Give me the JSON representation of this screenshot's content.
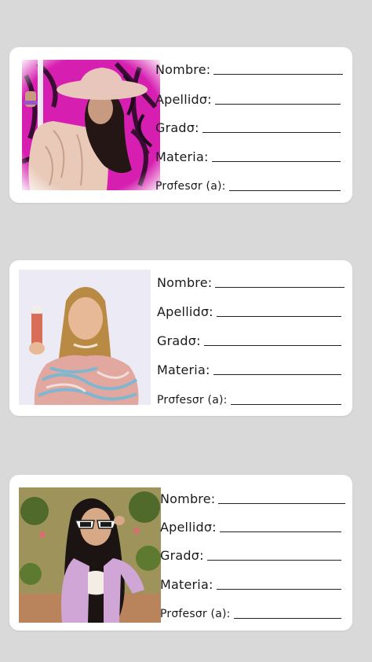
{
  "cards": [
    {
      "fields": [
        {
          "label": "Nombre:"
        },
        {
          "label": "Apellidσ:"
        },
        {
          "label": "Gradσ:"
        },
        {
          "label": "Materia:"
        },
        {
          "label": "Prσfesσr (a):"
        }
      ]
    },
    {
      "fields": [
        {
          "label": "Nombre:"
        },
        {
          "label": "Apellidσ:"
        },
        {
          "label": "Gradσ:"
        },
        {
          "label": "Materia:"
        },
        {
          "label": "Prσfesσr (a):"
        }
      ]
    },
    {
      "fields": [
        {
          "label": "Nombre:"
        },
        {
          "label": "Apellidσ:"
        },
        {
          "label": "Gradσ:"
        },
        {
          "label": "Materia:"
        },
        {
          "label": "Prσfesσr (a):"
        }
      ]
    }
  ],
  "colors": {
    "page_background": "#d9d9d9",
    "card_background": "#ffffff",
    "line_color": "#222222",
    "photo1_background": "#d61fb0",
    "photo2_background": "#eceaf4",
    "photo3_background": "#6b7d3e"
  }
}
